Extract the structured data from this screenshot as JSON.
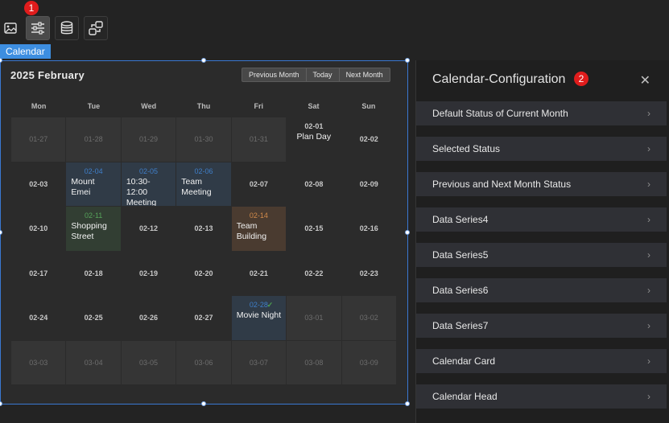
{
  "toolbar": {
    "badge": "1",
    "tools": [
      {
        "icon": "image-icon",
        "active": false
      },
      {
        "icon": "sliders-icon",
        "active": true
      },
      {
        "icon": "database-icon",
        "active": false
      },
      {
        "icon": "interaction-icon",
        "active": false
      }
    ]
  },
  "component_tag": "Calendar",
  "calendar": {
    "title": "2025 February",
    "nav": {
      "prev": "Previous Month",
      "today": "Today",
      "next": "Next Month"
    },
    "weekdays": [
      "Mon",
      "Tue",
      "Wed",
      "Thu",
      "Fri",
      "Sat",
      "Sun"
    ],
    "weeks": [
      [
        {
          "date": "01-27",
          "other": true
        },
        {
          "date": "01-28",
          "other": true
        },
        {
          "date": "01-29",
          "other": true
        },
        {
          "date": "01-30",
          "other": true
        },
        {
          "date": "01-31",
          "other": true
        },
        {
          "date": "02-01",
          "event": "Plan Day",
          "style": "plain"
        },
        {
          "date": "02-02"
        }
      ],
      [
        {
          "date": "02-03"
        },
        {
          "date": "02-04",
          "event": "Mount Emei",
          "style": "blue"
        },
        {
          "date": "02-05",
          "event": "10:30-12:00 Meeting",
          "style": "blue"
        },
        {
          "date": "02-06",
          "event": "Team Meeting",
          "style": "blue"
        },
        {
          "date": "02-07"
        },
        {
          "date": "02-08"
        },
        {
          "date": "02-09"
        }
      ],
      [
        {
          "date": "02-10"
        },
        {
          "date": "02-11",
          "event": "Shopping Street",
          "style": "green"
        },
        {
          "date": "02-12"
        },
        {
          "date": "02-13"
        },
        {
          "date": "02-14",
          "event": "Team Building",
          "style": "orange"
        },
        {
          "date": "02-15"
        },
        {
          "date": "02-16"
        }
      ],
      [
        {
          "date": "02-17"
        },
        {
          "date": "02-18"
        },
        {
          "date": "02-19"
        },
        {
          "date": "02-20"
        },
        {
          "date": "02-21"
        },
        {
          "date": "02-22"
        },
        {
          "date": "02-23"
        }
      ],
      [
        {
          "date": "02-24"
        },
        {
          "date": "02-25"
        },
        {
          "date": "02-26"
        },
        {
          "date": "02-27"
        },
        {
          "date": "02-28",
          "event": "Movie Night",
          "style": "blue",
          "check": true
        },
        {
          "date": "03-01",
          "other": true
        },
        {
          "date": "03-02",
          "other": true
        }
      ],
      [
        {
          "date": "03-03",
          "other": true
        },
        {
          "date": "03-04",
          "other": true
        },
        {
          "date": "03-05",
          "other": true
        },
        {
          "date": "03-06",
          "other": true
        },
        {
          "date": "03-07",
          "other": true
        },
        {
          "date": "03-08",
          "other": true
        },
        {
          "date": "03-09",
          "other": true
        }
      ]
    ]
  },
  "config": {
    "title": "Calendar-Configuration",
    "badge": "2",
    "items": [
      "Default Status of Current Month",
      "Selected Status",
      "Previous and Next Month Status",
      "Data Series4",
      "Data Series5",
      "Data Series6",
      "Data Series7",
      "Calendar Card",
      "Calendar Head"
    ]
  },
  "colors": {
    "accent": "#3d8ee0",
    "badge": "#e01c1c",
    "event_blue": "#303b47",
    "event_green": "#323e33",
    "event_orange": "#4a3b30"
  }
}
